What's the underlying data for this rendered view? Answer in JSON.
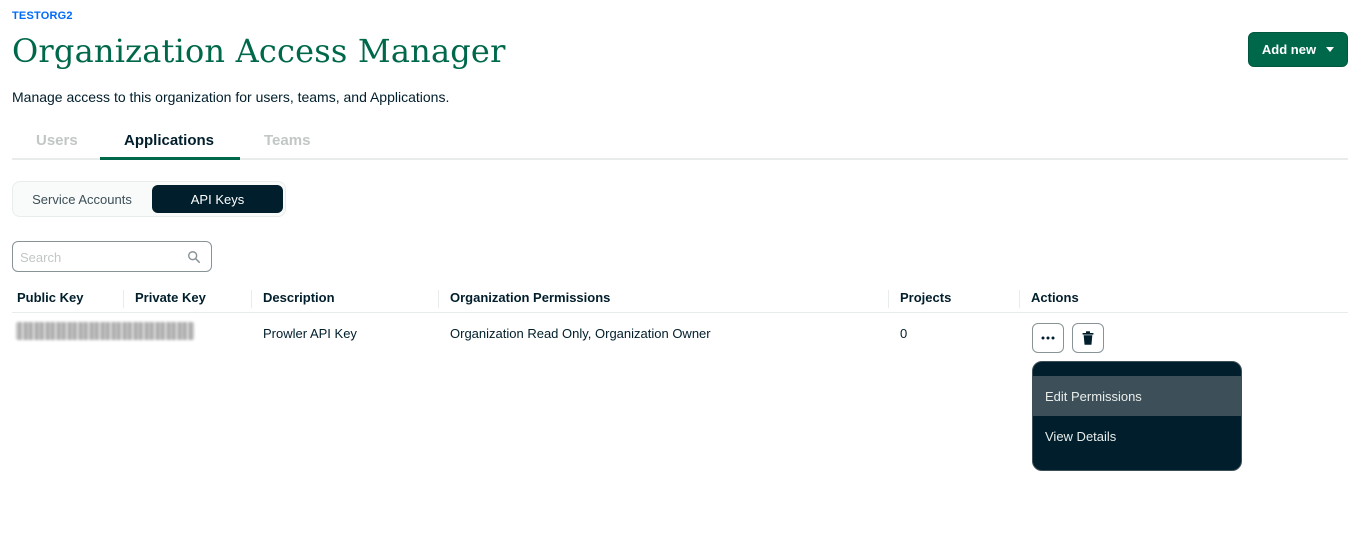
{
  "header": {
    "org_name": "TESTORG2",
    "title": "Organization Access Manager",
    "description": "Manage access to this organization for users, teams, and Applications.",
    "add_new_label": "Add new"
  },
  "tabs": [
    {
      "label": "Users",
      "active": false
    },
    {
      "label": "Applications",
      "active": true
    },
    {
      "label": "Teams",
      "active": false
    }
  ],
  "segmented": {
    "options": [
      "Service Accounts",
      "API Keys"
    ],
    "selected": "API Keys"
  },
  "search": {
    "placeholder": "Search",
    "value": ""
  },
  "table": {
    "columns": [
      "Public Key",
      "Private Key",
      "Description",
      "Organization Permissions",
      "Projects",
      "Actions"
    ],
    "rows": [
      {
        "public_key": "",
        "private_key": "",
        "description": "Prowler API Key",
        "permissions": "Organization Read Only, Organization Owner",
        "projects": "0"
      }
    ]
  },
  "actions_menu": {
    "items": [
      "Edit Permissions",
      "View Details"
    ],
    "highlighted": "Edit Permissions"
  },
  "icons": {
    "search": "search-icon",
    "more": "ellipsis-icon",
    "delete": "trash-icon",
    "caret": "caret-down-icon"
  },
  "colors": {
    "brand_green": "#00684a",
    "org_blue": "#016bf8",
    "dark_navy": "#001e2b",
    "menu_highlight": "#3d4f58"
  }
}
